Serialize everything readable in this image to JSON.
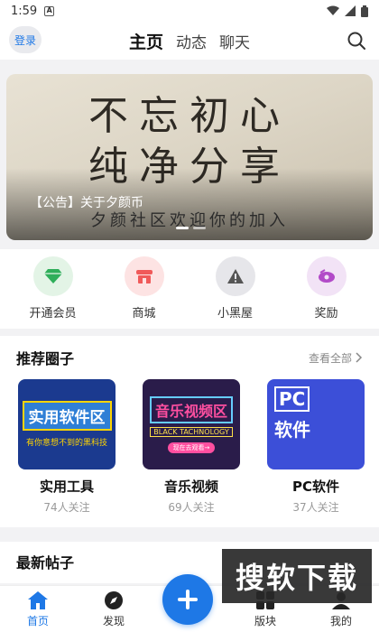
{
  "status_bar": {
    "time": "1:59",
    "notification_glyph": "A"
  },
  "top_bar": {
    "login_label": "登录",
    "tabs": [
      {
        "label": "主页",
        "active": true
      },
      {
        "label": "动态",
        "active": false
      },
      {
        "label": "聊天",
        "active": false
      }
    ],
    "search_icon": "search-icon"
  },
  "banner": {
    "line1": "不忘初心",
    "line2": "纯净分享",
    "caption": "【公告】关于夕颜币",
    "motto": "夕颜社区欢迎你的加入",
    "slide_count": 2,
    "active_slide": 1
  },
  "quick_actions": [
    {
      "label": "开通会员",
      "icon": "diamond-icon",
      "bg": "#e3f4e6",
      "fg": "#2fae5a"
    },
    {
      "label": "商城",
      "icon": "shop-icon",
      "bg": "#fde3e3",
      "fg": "#f05a5a"
    },
    {
      "label": "小黑屋",
      "icon": "warning-icon",
      "bg": "#e6e6ea",
      "fg": "#555555"
    },
    {
      "label": "奖励",
      "icon": "gift-icon",
      "bg": "#f2e3f6",
      "fg": "#b24ac8"
    }
  ],
  "recommended": {
    "title": "推荐圈子",
    "view_all": "查看全部",
    "cards": [
      {
        "title": "实用工具",
        "followers": "74人关注",
        "img_big": "实用软件区",
        "img_small": "有你意想不到的黑科技"
      },
      {
        "title": "音乐视频",
        "followers": "69人关注",
        "img_big": "音乐视频区",
        "img_small": "BLACK TACHNOLOGY",
        "img_pill": "现在去观看→"
      },
      {
        "title": "PC软件",
        "followers": "37人关注",
        "img_big": "PC",
        "img_small": "软件"
      }
    ]
  },
  "latest": {
    "title": "最新帖子"
  },
  "watermark": "搜软下载",
  "bottom_nav": [
    {
      "label": "首页",
      "icon": "home-icon",
      "active": true
    },
    {
      "label": "发现",
      "icon": "compass-icon",
      "active": false
    },
    {
      "label": "版块",
      "icon": "blocks-icon",
      "active": false
    },
    {
      "label": "我的",
      "icon": "profile-icon",
      "active": false
    }
  ],
  "colors": {
    "accent": "#1e78e6",
    "page_bg": "#f2f2f4"
  }
}
